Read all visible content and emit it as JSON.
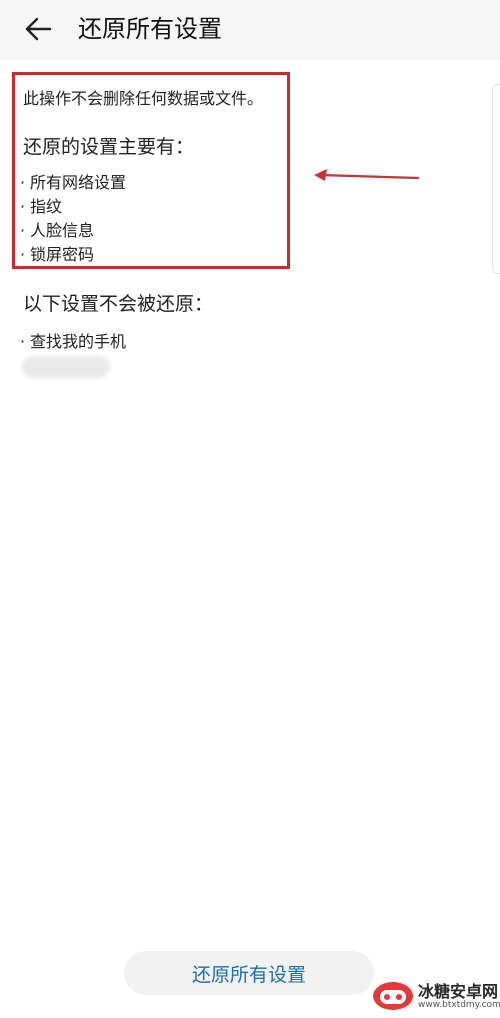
{
  "header": {
    "title": "还原所有设置"
  },
  "content": {
    "intro": "此操作不会删除任何数据或文件。",
    "restored_heading": "还原的设置主要有：",
    "restored_items": [
      "所有网络设置",
      "指纹",
      "人脸信息",
      "锁屏密码"
    ],
    "not_restored_heading": "以下设置不会被还原：",
    "not_restored_items": [
      "查找我的手机"
    ]
  },
  "footer": {
    "reset_button_label": "还原所有设置"
  },
  "watermark": {
    "name": "冰糖安卓网",
    "url": "www.btxtdmy.com"
  },
  "colors": {
    "highlight": "#d8242e",
    "arrow": "#c8323a",
    "button_text": "#1a6fb0",
    "header_bg": "#f6f6f6"
  },
  "icons": {
    "back": "arrow-left-icon",
    "annotation": "annotation-arrow-icon",
    "logo": "watermark-logo-icon"
  }
}
